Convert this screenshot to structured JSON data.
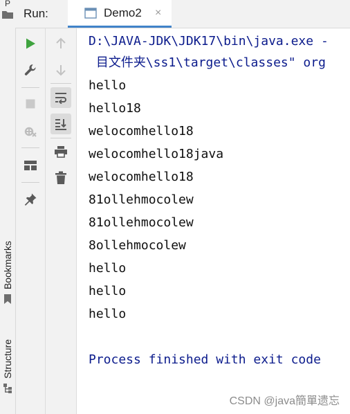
{
  "left_strip": {
    "top_label": "P",
    "bookmarks_label": "Bookmarks",
    "structure_label": "Structure"
  },
  "header": {
    "run_label": "Run:",
    "tab_title": "Demo2",
    "tab_close_glyph": "×"
  },
  "toolbar": {
    "icons": [
      "rerun-icon",
      "wrench-icon",
      "stop-icon",
      "exit-icon",
      "layout-icon",
      "pin-icon",
      "up-arrow-icon",
      "down-arrow-icon",
      "soft-wrap-icon",
      "scroll-to-end-icon",
      "print-icon",
      "trash-icon"
    ]
  },
  "console": {
    "cmd_line": "D:\\JAVA-JDK\\JDK17\\bin\\java.exe -",
    "cmd_line2": " 目文件夹\\ss1\\target\\classes\" org",
    "output": [
      "hello",
      "hello18",
      "welocomhello18",
      "welocomhello18java",
      "welocomhello18",
      "81ollehmocolew",
      "81ollehmocolew",
      "8ollehmocolew",
      "hello",
      "hello",
      "hello"
    ],
    "finish_line": "Process finished with exit code"
  },
  "watermark": "CSDN @java簡單遗忘",
  "colors": {
    "accent": "#4083c9",
    "run_green": "#3fa33f",
    "console_blue": "#0b1b8c",
    "icon_gray": "#5a5a5a"
  }
}
